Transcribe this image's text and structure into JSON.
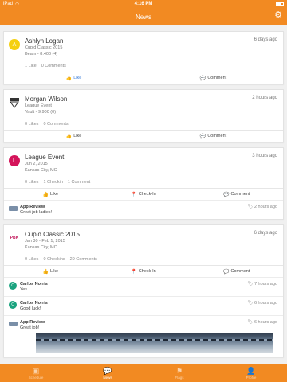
{
  "status": {
    "carrier": "iPad",
    "time": "4:16 PM"
  },
  "nav": {
    "title": "News"
  },
  "feed": {
    "card1": {
      "avatar": "A",
      "title": "Ashlyn Logan",
      "line1": "Cupid Classic 2015",
      "line2": "Beam - 8.400 (4)",
      "time": "6 days ago",
      "count1": "1 Like",
      "count2": "0 Comments",
      "like": "Like",
      "comment": "Comment"
    },
    "card2": {
      "title": "Morgan Wilson",
      "line1": "League Event",
      "line2": "Vault - 9.900 (0)",
      "time": "2 hours ago",
      "count1": "0 Likes",
      "count2": "0 Comments",
      "like": "Like",
      "comment": "Comment"
    },
    "card3": {
      "avatar": "L",
      "title": "League Event",
      "line1": "Jun 2, 2015",
      "line2": "Kansas City, MO",
      "time": "3 hours ago",
      "count1": "0 Likes",
      "count2": "1 Checkin",
      "count3": "1 Comment",
      "like": "Like",
      "checkin": "Check-In",
      "comment": "Comment",
      "comments": [
        {
          "name": "App Review",
          "text": "Great job ladies!",
          "time": "2 hours ago"
        }
      ]
    },
    "card4": {
      "avatar": "PBK",
      "title": "Cupid Classic 2015",
      "line1": "Jan 30 - Feb 1, 2015",
      "line2": "Kansas City, MO",
      "time": "6 days ago",
      "count1": "0 Likes",
      "count2": "0 Checkins",
      "count3": "29 Comments",
      "like": "Like",
      "checkin": "Check-In",
      "comment": "Comment",
      "comments": [
        {
          "avatar": "C",
          "name": "Carlos Norris",
          "text": "Yes",
          "time": "7 hours ago"
        },
        {
          "avatar": "C",
          "name": "Carlos Norris",
          "text": "Good luck!",
          "time": "6 hours ago"
        },
        {
          "name": "App Review",
          "text": "Great job!",
          "time": "6 hours ago"
        }
      ]
    }
  },
  "tabs": [
    {
      "label": "Schedule",
      "icon": "calendar-icon"
    },
    {
      "label": "News",
      "icon": "speech-bubble-icon",
      "active": true
    },
    {
      "label": "Flags",
      "icon": "flag-icon"
    },
    {
      "label": "Profile",
      "icon": "person-icon"
    }
  ],
  "colors": {
    "brand": "#f28a22",
    "like_active": "#3b7dd8",
    "comment_avatar": "#1aa37f"
  }
}
